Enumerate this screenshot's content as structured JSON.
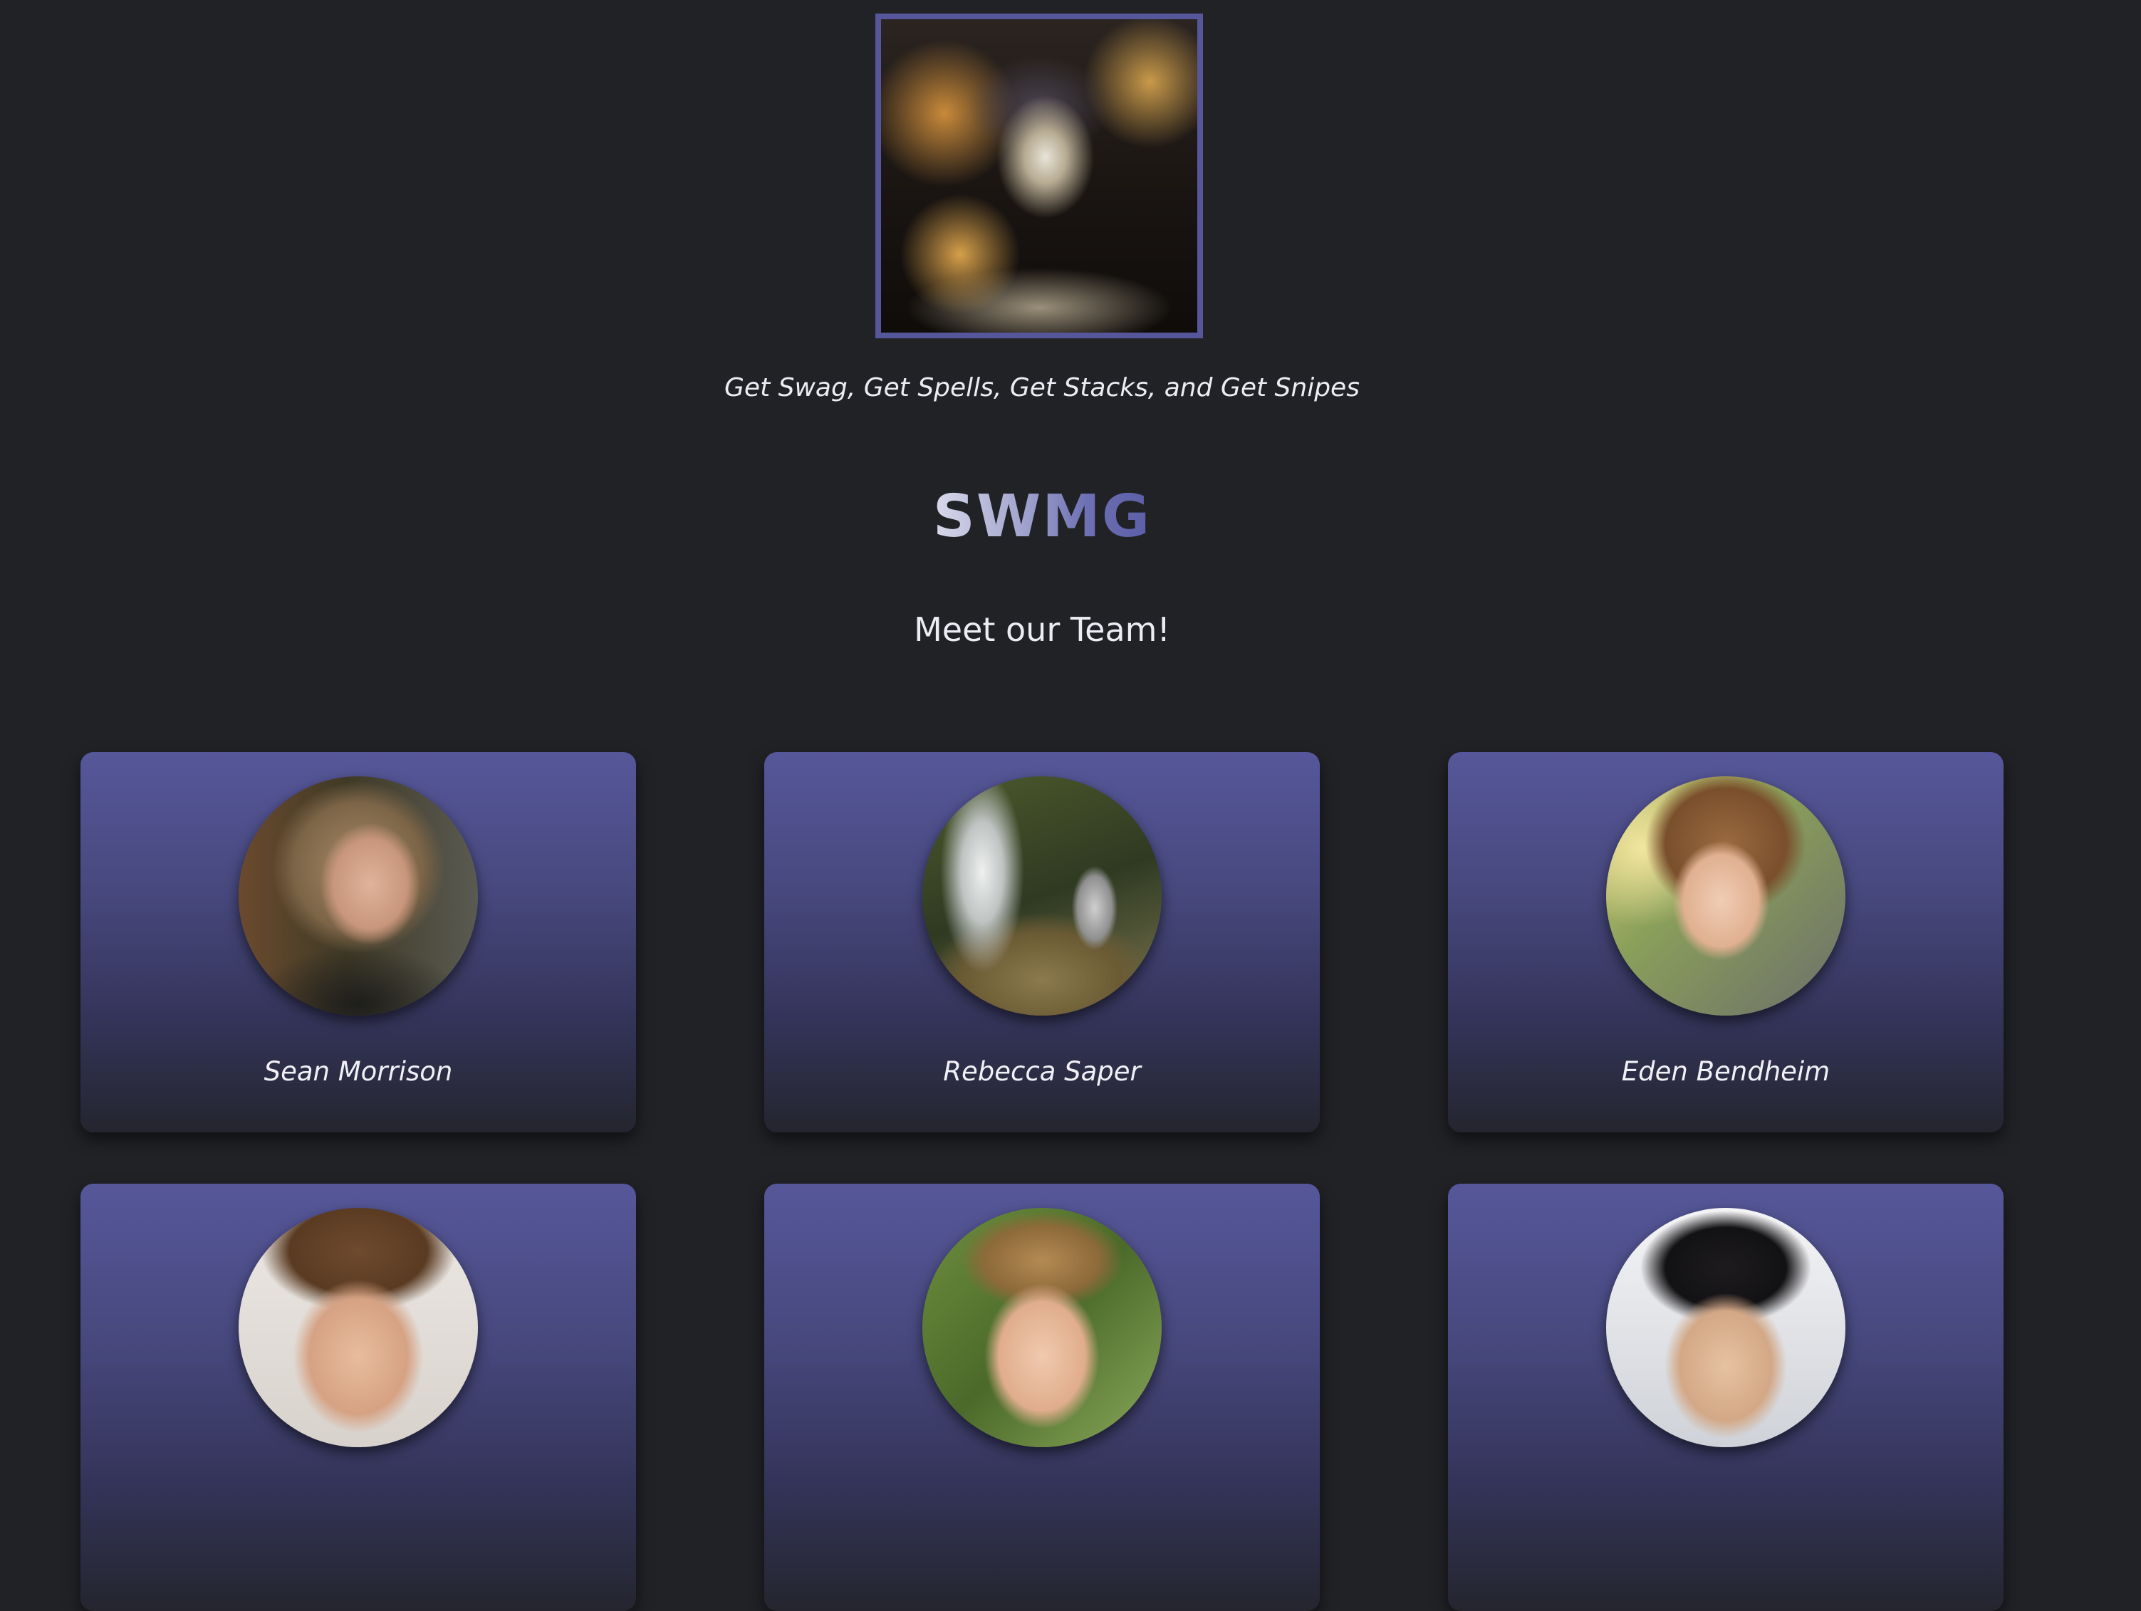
{
  "hero": {
    "tagline": "Get Swag, Get Spells, Get Stacks, and Get Snipes",
    "brand": "SWMG"
  },
  "team": {
    "heading": "Meet our Team!",
    "members": [
      {
        "name": "Sean Morrison"
      },
      {
        "name": "Rebecca Saper"
      },
      {
        "name": "Eden Bendheim"
      },
      {
        "name": ""
      },
      {
        "name": ""
      },
      {
        "name": ""
      }
    ]
  },
  "colors": {
    "background": "#212226",
    "accent": "#55579a",
    "card_top": "#56579a",
    "card_bottom": "#24252e"
  }
}
